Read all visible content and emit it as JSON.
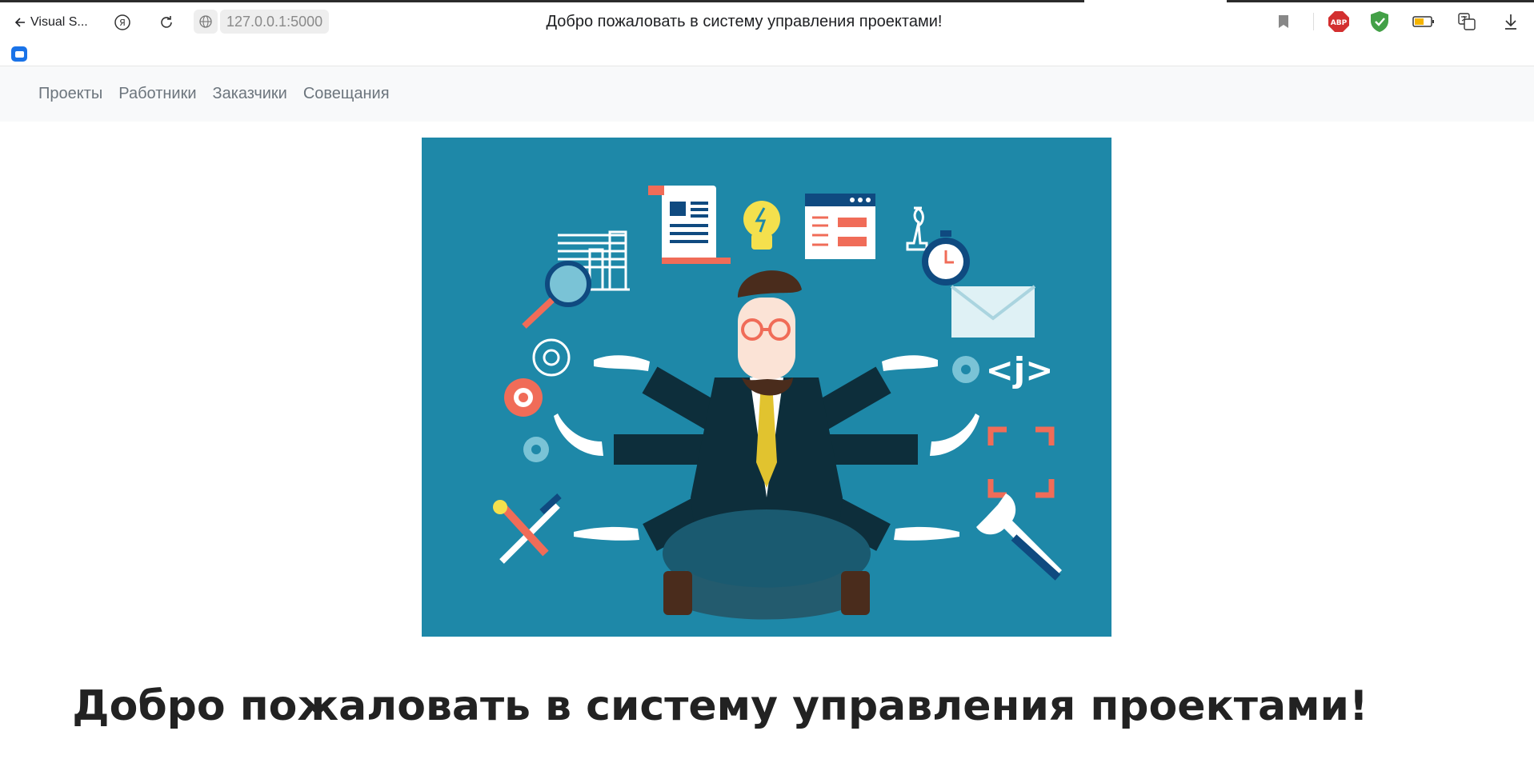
{
  "browser": {
    "back_label": "Visual S...",
    "url": "127.0.0.1:5000",
    "page_title": "Добро пожаловать в систему управления проектами!",
    "extensions": [
      "bookmark-icon",
      "adblock-icon",
      "shield-icon",
      "battery-icon",
      "translate-icon",
      "download-icon"
    ],
    "adblock_label": "ABP"
  },
  "navbar": {
    "items": [
      "Проекты",
      "Работники",
      "Заказчики",
      "Совещания"
    ]
  },
  "hero": {
    "image": "multitasking-businessman-illustration",
    "code_label": "<j>"
  },
  "main": {
    "heading": "Добро пожаловать в систему управления проектами!"
  },
  "colors": {
    "hero_bg": "#1e88a8",
    "navbar_bg": "#f8f9fa",
    "nav_text": "#6c757d",
    "accent": "#1a73e8"
  }
}
